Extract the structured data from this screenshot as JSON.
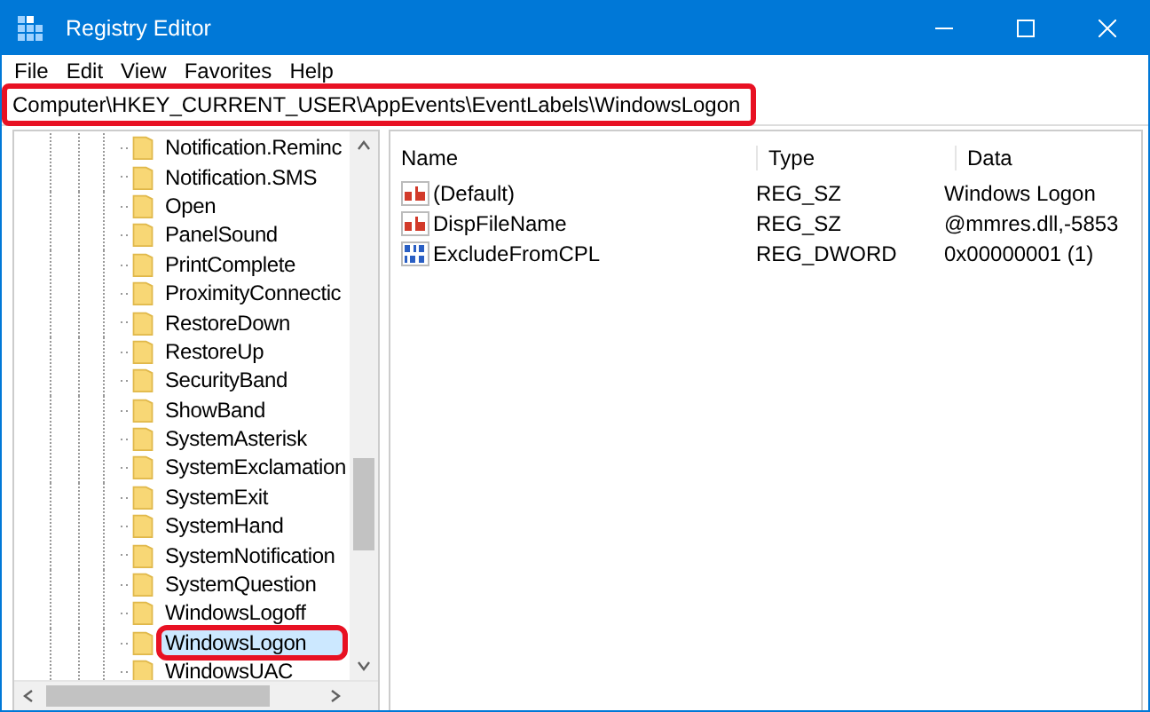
{
  "window": {
    "title": "Registry Editor"
  },
  "menu": [
    "File",
    "Edit",
    "View",
    "Favorites",
    "Help"
  ],
  "address_bar": {
    "value": "Computer\\HKEY_CURRENT_USER\\AppEvents\\EventLabels\\WindowsLogon",
    "highlighted": true
  },
  "tree": {
    "items": [
      {
        "label": "Notification.Reminc",
        "selected": false,
        "highlighted": false
      },
      {
        "label": "Notification.SMS",
        "selected": false,
        "highlighted": false
      },
      {
        "label": "Open",
        "selected": false,
        "highlighted": false
      },
      {
        "label": "PanelSound",
        "selected": false,
        "highlighted": false
      },
      {
        "label": "PrintComplete",
        "selected": false,
        "highlighted": false
      },
      {
        "label": "ProximityConnectic",
        "selected": false,
        "highlighted": false
      },
      {
        "label": "RestoreDown",
        "selected": false,
        "highlighted": false
      },
      {
        "label": "RestoreUp",
        "selected": false,
        "highlighted": false
      },
      {
        "label": "SecurityBand",
        "selected": false,
        "highlighted": false
      },
      {
        "label": "ShowBand",
        "selected": false,
        "highlighted": false
      },
      {
        "label": "SystemAsterisk",
        "selected": false,
        "highlighted": false
      },
      {
        "label": "SystemExclamation",
        "selected": false,
        "highlighted": false
      },
      {
        "label": "SystemExit",
        "selected": false,
        "highlighted": false
      },
      {
        "label": "SystemHand",
        "selected": false,
        "highlighted": false
      },
      {
        "label": "SystemNotification",
        "selected": false,
        "highlighted": false
      },
      {
        "label": "SystemQuestion",
        "selected": false,
        "highlighted": false
      },
      {
        "label": "WindowsLogoff",
        "selected": false,
        "highlighted": false
      },
      {
        "label": "WindowsLogon",
        "selected": true,
        "highlighted": true
      },
      {
        "label": "WindowsUAC",
        "selected": false,
        "highlighted": false
      }
    ]
  },
  "values": {
    "columns": [
      "Name",
      "Type",
      "Data"
    ],
    "rows": [
      {
        "kind": "string",
        "name": "(Default)",
        "type": "REG_SZ",
        "data": "Windows Logon"
      },
      {
        "kind": "string",
        "name": "DispFileName",
        "type": "REG_SZ",
        "data": "@mmres.dll,-5853"
      },
      {
        "kind": "binary",
        "name": "ExcludeFromCPL",
        "type": "REG_DWORD",
        "data": "0x00000001 (1)"
      }
    ]
  }
}
